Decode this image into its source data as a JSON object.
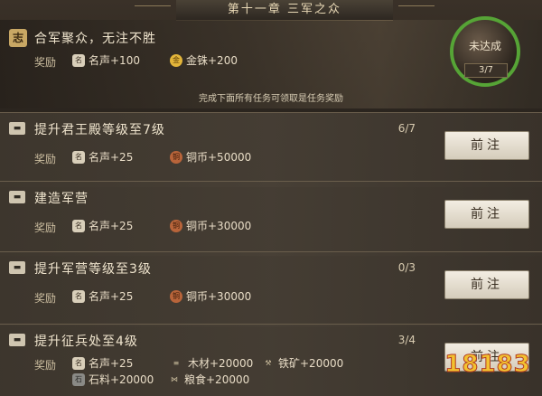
{
  "header": {
    "chapter_title": "第十一章  三军之众"
  },
  "main_quest": {
    "icon_char": "志",
    "title": "合军聚众，无注不胜",
    "reward_label": "奖励",
    "rewards": [
      {
        "icon": "fame-icon",
        "icon_char": "名",
        "text": "名声+100"
      },
      {
        "icon": "gold-icon",
        "icon_char": "金",
        "text": "金铢+200"
      }
    ],
    "note": "完成下面所有任务可领取是任务奖励",
    "status": "未达成",
    "progress": "3/7"
  },
  "quests": [
    {
      "title": "提升君王殿等级至7级",
      "progress": "6/7",
      "reward_label": "奖励",
      "rewards": [
        {
          "icon": "fame-icon",
          "icon_char": "名",
          "text": "名声+25"
        },
        {
          "icon": "copper-icon",
          "icon_char": "铜",
          "text": "铜币+50000"
        }
      ],
      "button": "前注"
    },
    {
      "title": "建造军营",
      "progress": "",
      "reward_label": "奖励",
      "rewards": [
        {
          "icon": "fame-icon",
          "icon_char": "名",
          "text": "名声+25"
        },
        {
          "icon": "copper-icon",
          "icon_char": "铜",
          "text": "铜币+30000"
        }
      ],
      "button": "前注"
    },
    {
      "title": "提升军营等级至3级",
      "progress": "0/3",
      "reward_label": "奖励",
      "rewards": [
        {
          "icon": "fame-icon",
          "icon_char": "名",
          "text": "名声+25"
        },
        {
          "icon": "copper-icon",
          "icon_char": "铜",
          "text": "铜币+30000"
        }
      ],
      "button": "前注"
    },
    {
      "title": "提升征兵处至4级",
      "progress": "3/4",
      "reward_label": "奖励",
      "rewards": [
        {
          "icon": "fame-icon",
          "icon_char": "名",
          "text": "名声+25"
        },
        {
          "icon": "wood-icon",
          "icon_char": "≡",
          "text": "木材+20000"
        },
        {
          "icon": "iron-icon",
          "icon_char": "⚒",
          "text": "铁矿+20000"
        },
        {
          "icon": "stone-icon",
          "icon_char": "石",
          "text": "石料+20000"
        },
        {
          "icon": "grain-icon",
          "icon_char": "⋈",
          "text": "粮食+20000"
        }
      ],
      "button": "前注"
    }
  ],
  "logo": {
    "text": "18183"
  }
}
